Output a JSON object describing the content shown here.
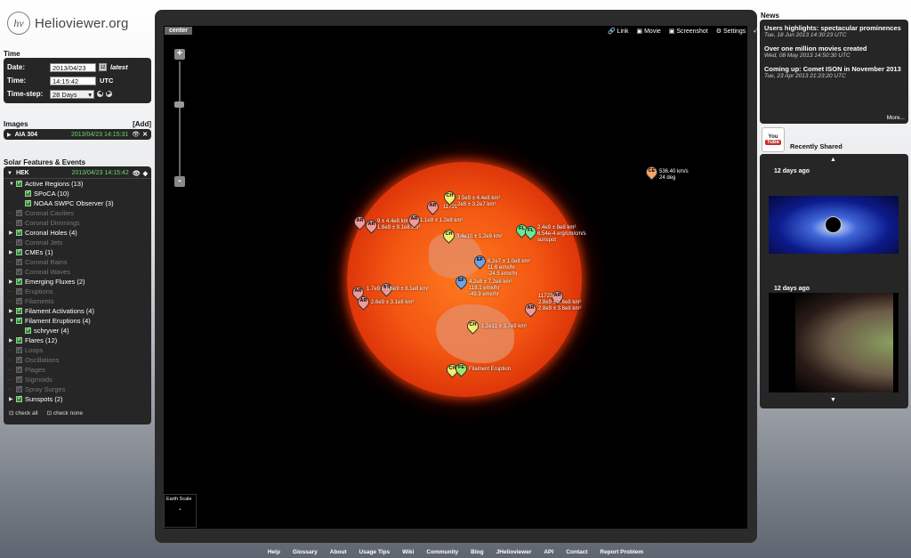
{
  "logo": {
    "text": "Helioviewer.org",
    "mark": "hv"
  },
  "time": {
    "title": "Time",
    "date_label": "Date:",
    "date_value": "2013/04/23",
    "latest": "latest",
    "time_label": "Time:",
    "time_value": "14:15:42",
    "utc": "UTC",
    "step_label": "Time-step:",
    "step_value": "28 Days"
  },
  "images": {
    "title": "Images",
    "add": "[Add]",
    "layer_name": "AIA 304",
    "layer_time": "2013/04/23 14:15:31"
  },
  "features": {
    "title": "Solar Features & Events",
    "source": "HEK",
    "source_time": "2013/04/23 14:15:42",
    "items": [
      {
        "label": "Active Regions (13)"
      },
      {
        "label": "SPoCA (10)"
      },
      {
        "label": "NOAA SWPC Observer (3)"
      },
      {
        "label": "Coronal Cavities"
      },
      {
        "label": "Coronal Dimmings"
      },
      {
        "label": "Coronal Holes (4)"
      },
      {
        "label": "Coronal Jets"
      },
      {
        "label": "CMEs (1)"
      },
      {
        "label": "Coronal Rains"
      },
      {
        "label": "Coronal Waves"
      },
      {
        "label": "Emerging Fluxes (2)"
      },
      {
        "label": "Eruptions"
      },
      {
        "label": "Filaments"
      },
      {
        "label": "Filament Activations (4)"
      },
      {
        "label": "Filament Eruptions (4)"
      },
      {
        "label": "schryver (4)"
      },
      {
        "label": "Flares (12)"
      },
      {
        "label": "Loops"
      },
      {
        "label": "Oscillations"
      },
      {
        "label": "Plages"
      },
      {
        "label": "Sigmoids"
      },
      {
        "label": "Spray Surges"
      },
      {
        "label": "Sunspots (2)"
      }
    ],
    "check_all": "check all",
    "check_none": "check none"
  },
  "viewport": {
    "center": "center",
    "tools": {
      "link": "Link",
      "movie": "Movie",
      "screenshot": "Screenshot",
      "settings": "Settings"
    },
    "zoom_in": "+",
    "zoom_out": "-",
    "earth_scale": "Earth Scale"
  },
  "markers": [
    {
      "type": "AR",
      "label": ""
    },
    {
      "type": "AR",
      "label": "9 ± 4.4e8 km²\n1.6e9 ± 9.1e8 km²"
    },
    {
      "type": "AR",
      "label": "1.1e9 ± 1.2e8 km²"
    },
    {
      "type": "AR",
      "label": "11721"
    },
    {
      "type": "CH",
      "label": "3.5e9 ± 4.4e8 km²\n2e8 ± 3.2e7 km²"
    },
    {
      "type": "CH",
      "label": "3.4e10 ± 1.2e9 km²"
    },
    {
      "type": "FL",
      "label": "2.4e9 ± 8e8 km²\n6.54e-4 erg/cm/cm/s\nsunspot"
    },
    {
      "type": "EF",
      "label": "6.2e7 ± 1.0e8 km²\n11.6 emx/hr\n-24.5 emx/hr"
    },
    {
      "type": "EF",
      "label": "4.2e8 ± 7.2e8 km²\n118.1 emx/hr\n-49.9 emx/hr"
    },
    {
      "type": "AR",
      "label": "1.7e9 ± 6.6e9 ± 8.1e8 km²"
    },
    {
      "type": "AR",
      "label": "2.6e9 ± 3.1e8 km²"
    },
    {
      "type": "CH",
      "label": "1.2e11 ± 3.7e9 km²"
    },
    {
      "type": "AR",
      "label": "11723\n2.8e9 ± 7.6e8 km²\n2.8e9 ± 3.6e8 km²"
    },
    {
      "type": "CE",
      "label": "536.40 km/s\n24 deg"
    },
    {
      "type": "FE",
      "label": "Filament Eruption"
    }
  ],
  "news": {
    "title": "News",
    "items": [
      {
        "headline": "Users highlights: spectacular prominences",
        "date": "Tue, 18 Jun 2013 14:30:23 UTC"
      },
      {
        "headline": "Over one million movies created",
        "date": "Wed, 08 May 2013 14:50:30 UTC"
      },
      {
        "headline": "Coming up: Comet ISON in November 2013",
        "date": "Tue, 23 Apr 2013 21:23:20 UTC"
      }
    ],
    "more": "More..."
  },
  "recent": {
    "title": "Recently Shared",
    "youtube_you": "You",
    "youtube_tube": "Tube",
    "videos": [
      {
        "ago": "12 days ago"
      },
      {
        "ago": "12 days ago"
      }
    ]
  },
  "footer": [
    "Help",
    "Glossary",
    "About",
    "Usage Tips",
    "Wiki",
    "Community",
    "Blog",
    "JHelioviewer",
    "API",
    "Contact",
    "Report Problem"
  ]
}
